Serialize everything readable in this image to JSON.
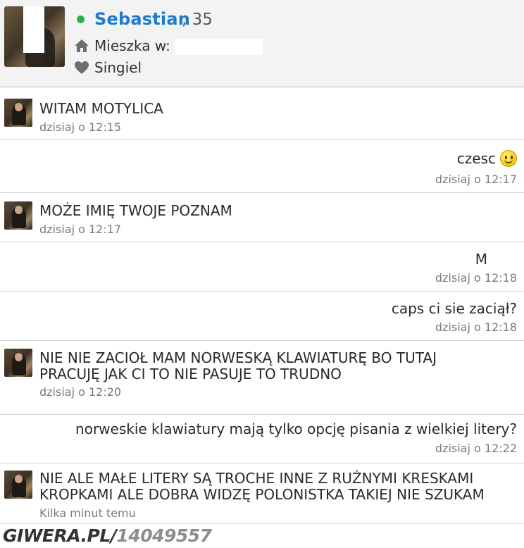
{
  "profile": {
    "name": "Sebastian",
    "age": ", 35",
    "city_label": "Mieszka w:",
    "relationship": "Singiel",
    "online_color": "#2db04b",
    "name_color": "#1b7bd2",
    "icons": {
      "city": "home-icon",
      "relationship": "heart-icon"
    }
  },
  "messages": [
    {
      "side": "left",
      "text": "WITAM MOTYLICA",
      "time": "dzisiaj o 12:15"
    },
    {
      "side": "right",
      "text": "czesc",
      "emoji": "smiley-icon",
      "time": "dzisiaj o 12:17"
    },
    {
      "side": "left",
      "text": "MOŻE IMIĘ TWOJE POZNAM",
      "time": "dzisiaj o 12:17"
    },
    {
      "side": "right",
      "text": "M",
      "time": "dzisiaj o 12:18"
    },
    {
      "side": "right",
      "text": "caps ci sie zaciął?",
      "time": "dzisiaj o 12:18"
    },
    {
      "side": "left",
      "text": "NIE NIE ZACIOŁ MAM NORWESKĄ KLAWIATURĘ BO TUTAJ\nPRACUJĘ JAK CI TO NIE PASUJE TO TRUDNO",
      "time": "dzisiaj o 12:20"
    },
    {
      "side": "right",
      "text": "norweskie klawiatury mają tylko opcję pisania z wielkiej litery?",
      "time": "dzisiaj o 12:22"
    },
    {
      "side": "left",
      "text": "NIE ALE MAŁE LITERY SĄ TROCHE INNE Z RUŻNYMI KRESKAMI\nKROPKAMI ALE DOBRA WIDZĘ POLONISTKA TAKIEJ NIE SZUKAM",
      "time": "Kilka minut temu"
    }
  ],
  "watermark": {
    "site": "GIWERA.PL/",
    "id": "14049557"
  }
}
